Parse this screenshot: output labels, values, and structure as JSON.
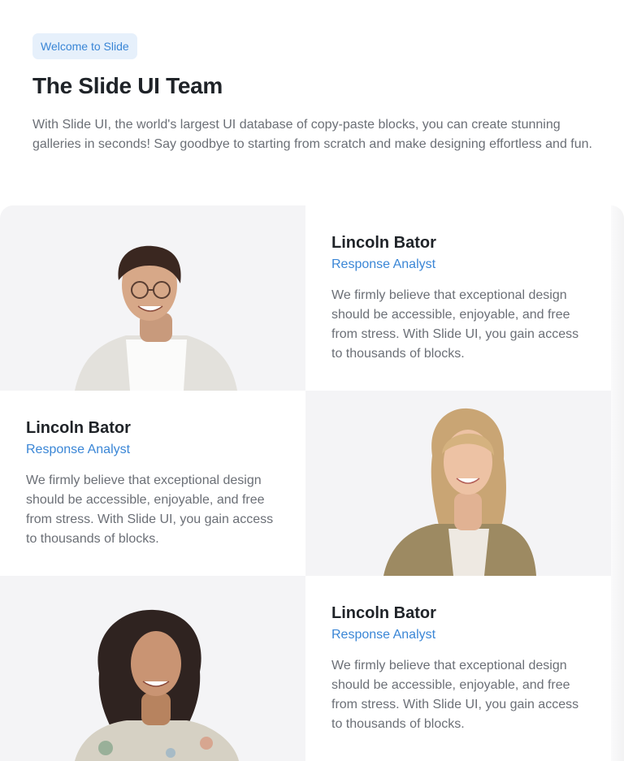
{
  "header": {
    "badge": "Welcome to Slide",
    "title": "The Slide UI Team",
    "lead": "With Slide UI, the world's largest UI database of copy-paste blocks, you can create stunning galleries in seconds! Say goodbye to starting from scratch and make designing effortless and fun."
  },
  "team": [
    {
      "name": "Lincoln Bator",
      "role": "Response Analyst",
      "bio": "We firmly believe that exceptional design should be accessible, enjoyable, and free from stress. With Slide UI, you gain access to thousands of blocks."
    },
    {
      "name": "Lincoln Bator",
      "role": "Response Analyst",
      "bio": "We firmly believe that exceptional design should be accessible, enjoyable, and free from stress. With Slide UI, you gain access to thousands of blocks."
    },
    {
      "name": "Lincoln Bator",
      "role": "Response Analyst",
      "bio": "We firmly believe that exceptional design should be accessible, enjoyable, and free from stress. With Slide UI, you gain access to thousands of blocks."
    }
  ],
  "colors": {
    "accent": "#3a86d6",
    "badge_bg": "#e6f0fb",
    "photo_bg": "#f4f4f6"
  }
}
